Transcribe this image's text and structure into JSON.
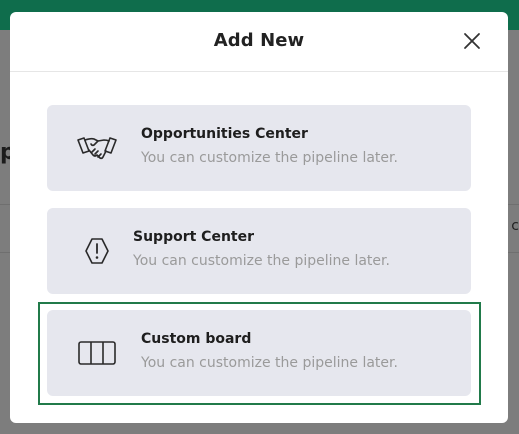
{
  "modal": {
    "title": "Add New",
    "close_icon": "close-icon"
  },
  "options": [
    {
      "title": "Opportunities Center",
      "description": "You can customize the pipeline later.",
      "icon": "handshake-icon"
    },
    {
      "title": "Support Center",
      "description": "You can customize the pipeline later.",
      "icon": "alert-hexagon-icon"
    },
    {
      "title": "Custom board",
      "description": "You can customize the pipeline later.",
      "icon": "columns-icon",
      "selected": true
    }
  ],
  "colors": {
    "accent": "#217a4a",
    "topbar": "#0f6d4c",
    "option_bg": "#e6e7ee"
  },
  "background": {
    "partial_letter": "p",
    "partial_right_glyph": "c"
  }
}
